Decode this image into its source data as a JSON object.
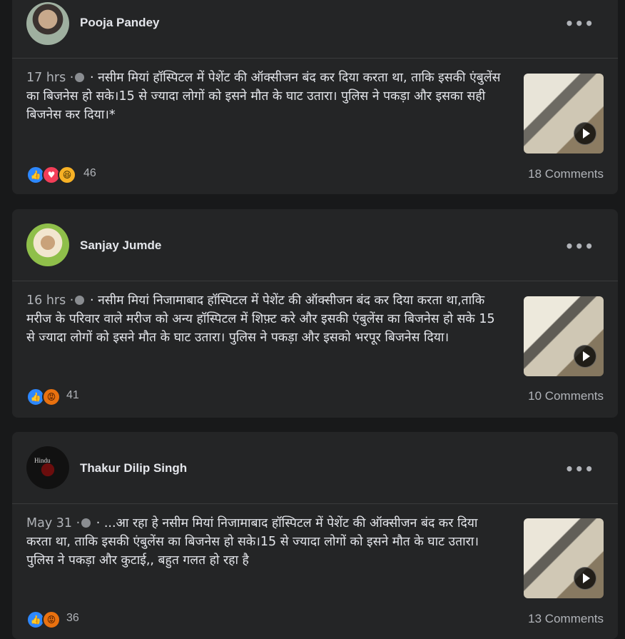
{
  "posts": [
    {
      "author": "Pooja Pandey",
      "time": "17 hrs ·",
      "text": " · नसीम मियां हॉस्पिटल में पेशेंट की ऑक्सीजन बंद कर दिया करता था, ताकि इसकी एंबुलेंस का बिजनेस हो सके।15 से ज्यादा लोगों को इसने मौत के घाट उतारा। पुलिस ने पकड़ा और इसका सही बिजनेस कर दिया।*",
      "reaction_count": "46",
      "comments": "18 Comments",
      "avatar_icon": "user-avatar-child",
      "reactions": [
        "like",
        "love",
        "haha"
      ]
    },
    {
      "author": "Sanjay Jumde",
      "time": "16 hrs ·",
      "text": " · नसीम मियां निजामाबाद हॉस्पिटल में पेशेंट की ऑक्सीजन बंद कर दिया करता था,ताकि मरीज के परिवार वाले मरीज को अन्य हॉस्पिटल में शिफ़्ट करे और इसकी एंबुलेंस का बिजनेस हो सके 15 से ज्यादा लोगों को इसने मौत के घाट उतारा। पुलिस ने पकड़ा और इसको भरपूर बिजनेस दिया।",
      "reaction_count": "41",
      "comments": "10 Comments",
      "avatar_icon": "user-avatar-man-outdoors",
      "reactions": [
        "like",
        "angry"
      ]
    },
    {
      "author": "Thakur Dilip Singh",
      "time": "May 31 ·",
      "text": " · ...आ रहा हे नसीम मियां निजामाबाद हॉस्पिटल में पेशेंट की ऑक्सीजन बंद कर दिया करता था, ताकि इसकी एंबुलेंस का बिजनेस हो सके।15 से ज्यादा लोगों को इसने मौत के घाट उतारा। पुलिस ने पकड़ा और कुटाई,, बहुत गलत हो रहा है",
      "reaction_count": "36",
      "comments": "13 Comments",
      "avatar_icon": "user-avatar-hindu-logo",
      "avatar_text": "Hindu",
      "reactions": [
        "like",
        "angry"
      ]
    }
  ],
  "more_label": "•••",
  "colors": {
    "background": "#18191a",
    "card": "#242526",
    "like": "#2d88ff",
    "love": "#f33e58",
    "haha": "#f7b125",
    "angry": "#e9710f"
  }
}
